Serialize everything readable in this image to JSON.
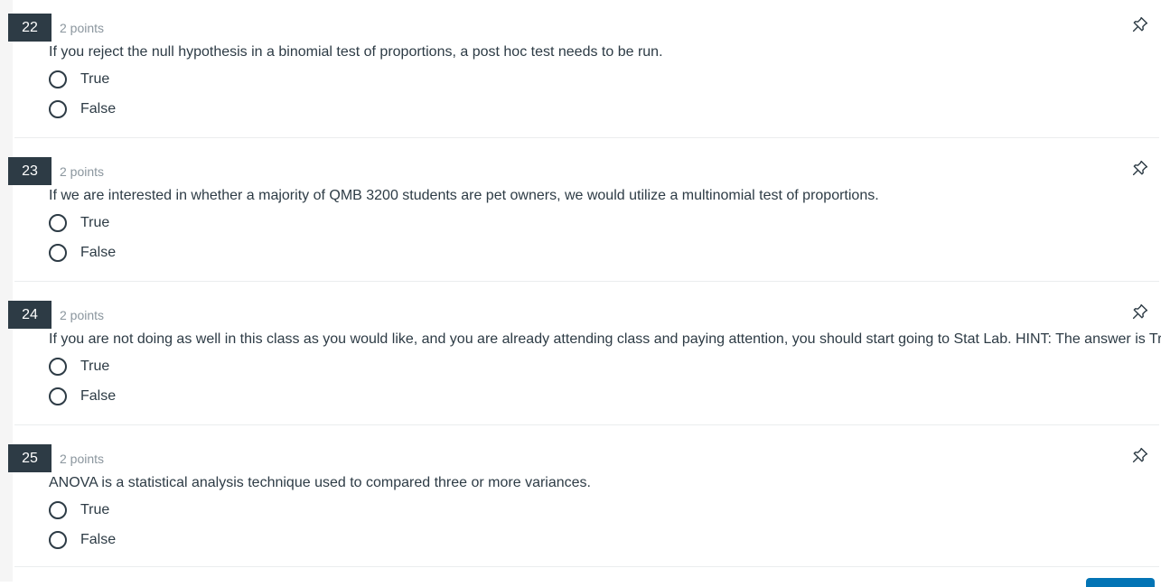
{
  "questions": [
    {
      "number": "22",
      "points": "2 points",
      "text": "If you reject the null hypothesis in a binomial test of proportions, a post hoc test needs to be run.",
      "options": [
        "True",
        "False"
      ]
    },
    {
      "number": "23",
      "points": "2 points",
      "text": "If we are interested in whether a majority of QMB 3200 students are pet owners, we would utilize a multinomial test of proportions.",
      "options": [
        "True",
        "False"
      ]
    },
    {
      "number": "24",
      "points": "2 points",
      "text": "If you are not doing as well in this class as you would like, and you are already attending class and paying attention, you should start going to Stat Lab. HINT: The answer is True.",
      "options": [
        "True",
        "False"
      ]
    },
    {
      "number": "25",
      "points": "2 points",
      "text": "ANOVA is a statistical analysis technique used to compared three or more variances.",
      "options": [
        "True",
        "False"
      ]
    }
  ],
  "icons": {
    "pin": "pin-icon"
  },
  "colors": {
    "question_number_bg": "#2d3b45",
    "text": "#2d3b45",
    "points": "#8b969e",
    "divider": "#ebedee",
    "button": "#0374b5"
  }
}
